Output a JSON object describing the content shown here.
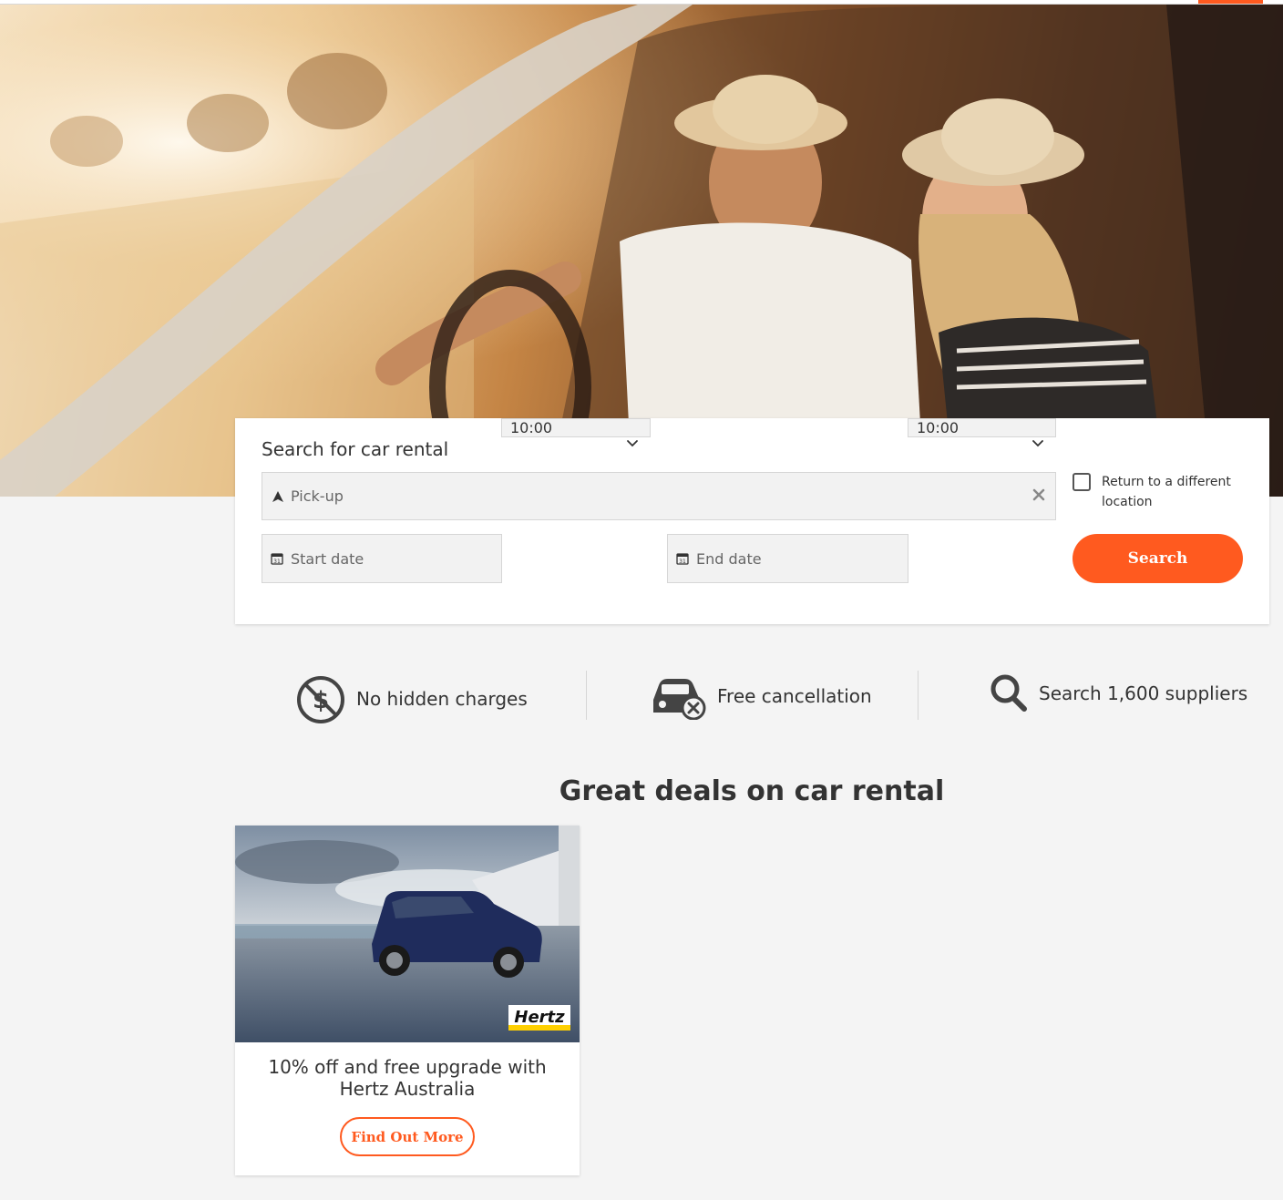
{
  "search": {
    "title": "Search for car rental",
    "pickup_placeholder": "Pick-up",
    "start_date_placeholder": "Start date",
    "start_time": "10:00",
    "end_date_placeholder": "End date",
    "end_time": "10:00",
    "return_label": "Return to a different location",
    "return_checked": false,
    "search_label": "Search"
  },
  "features": [
    {
      "icon": "no-dollar-icon",
      "label": "No hidden charges"
    },
    {
      "icon": "car-cancel-icon",
      "label": "Free cancellation"
    },
    {
      "icon": "magnifier-icon",
      "label": "Search 1,600 suppliers"
    }
  ],
  "deals": {
    "title": "Great deals on car rental",
    "items": [
      {
        "brand": "Hertz",
        "text": "10% off and free upgrade with Hertz Australia",
        "cta": "Find Out More"
      }
    ]
  },
  "colors": {
    "accent": "#ff5a1f",
    "background": "#f4f4f4",
    "text": "#333333"
  }
}
